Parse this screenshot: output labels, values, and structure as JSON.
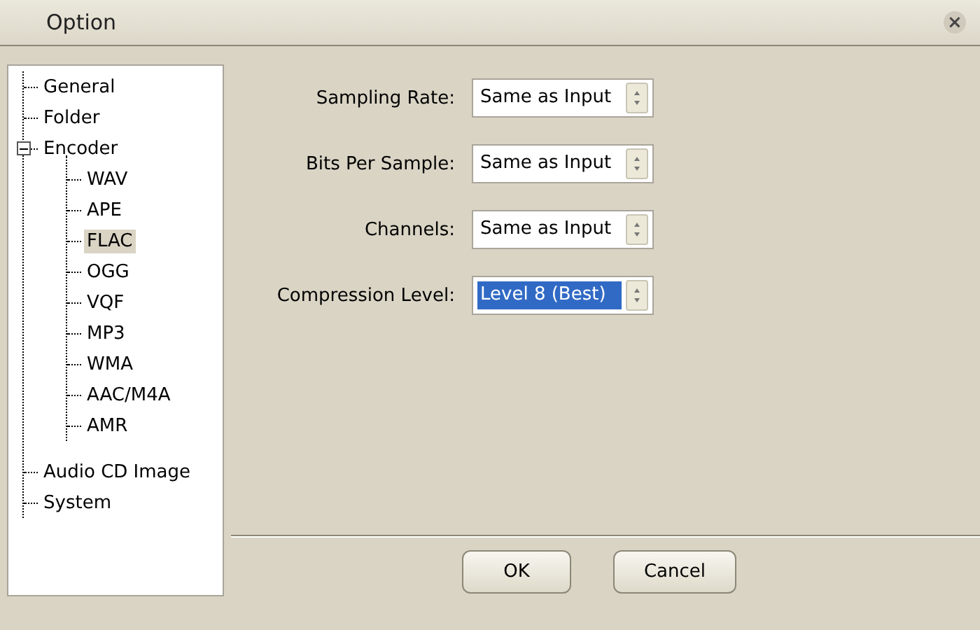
{
  "window": {
    "title": "Option",
    "close_icon": "×"
  },
  "tree": [
    {
      "label": "General",
      "selected": false
    },
    {
      "label": "Folder",
      "selected": false
    },
    {
      "label": "Encoder",
      "selected": false,
      "expanded": true,
      "children": [
        {
          "label": "WAV",
          "selected": false
        },
        {
          "label": "APE",
          "selected": false
        },
        {
          "label": "FLAC",
          "selected": true
        },
        {
          "label": "OGG",
          "selected": false
        },
        {
          "label": "VQF",
          "selected": false
        },
        {
          "label": "MP3",
          "selected": false
        },
        {
          "label": "WMA",
          "selected": false
        },
        {
          "label": "AAC/M4A",
          "selected": false
        },
        {
          "label": "AMR",
          "selected": false
        }
      ]
    },
    {
      "label": "Audio CD Image",
      "selected": false
    },
    {
      "label": "System",
      "selected": false
    }
  ],
  "settings": [
    {
      "label": "Sampling Rate:",
      "value": "Same as Input",
      "highlighted": false
    },
    {
      "label": "Bits Per Sample:",
      "value": "Same as Input",
      "highlighted": false
    },
    {
      "label": "Channels:",
      "value": "Same as Input",
      "highlighted": false
    },
    {
      "label": "Compression Level:",
      "value": "Level 8 (Best)",
      "highlighted": true
    }
  ],
  "buttons": [
    "OK",
    "Cancel"
  ]
}
